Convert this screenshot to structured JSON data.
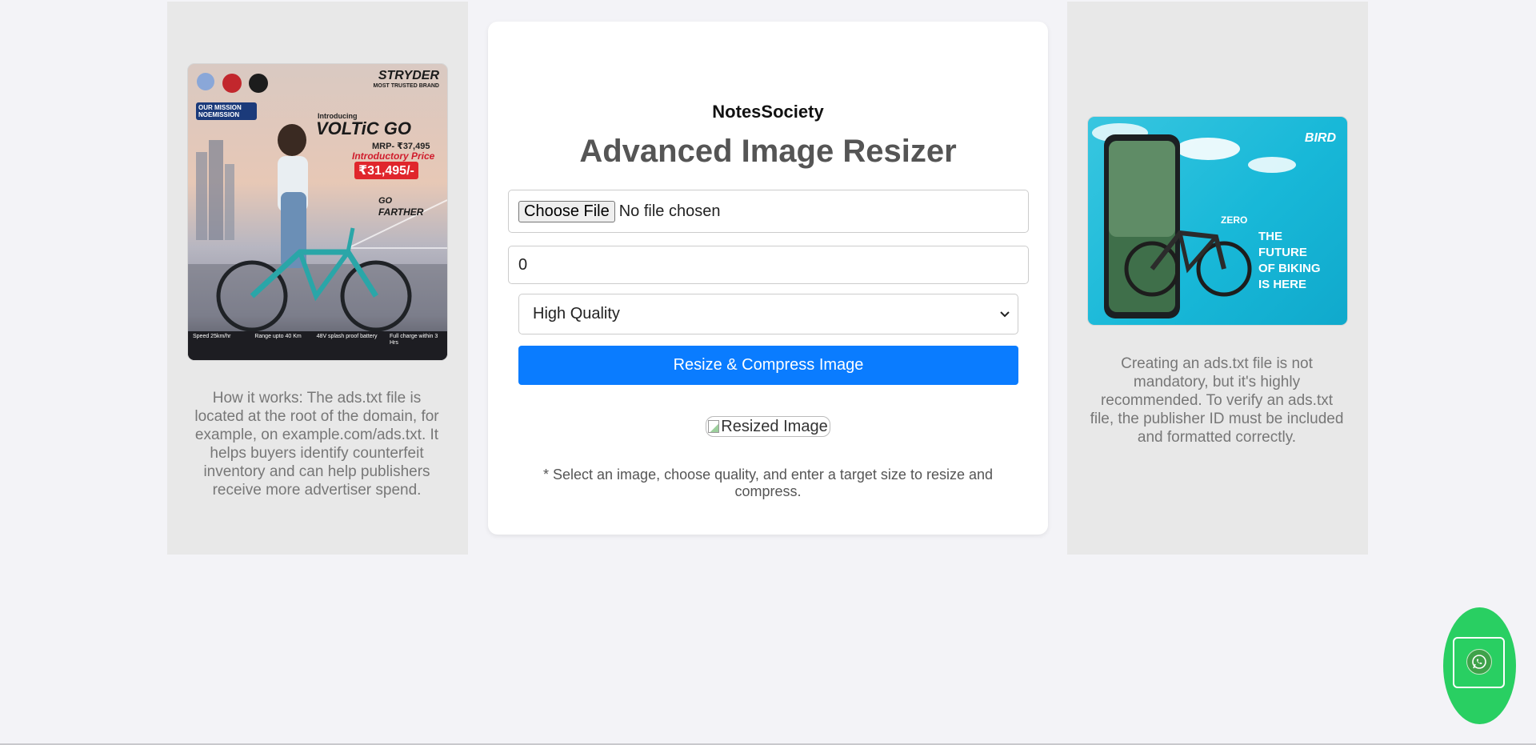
{
  "brand": "NotesSociety",
  "title": "Advanced Image Resizer",
  "file_input": {
    "button_label": "Choose File",
    "status": "No file chosen"
  },
  "target_size": {
    "value": "0"
  },
  "quality_select": {
    "selected": "High Quality"
  },
  "resize_button": "Resize & Compress Image",
  "resized_image_alt": "Resized Image",
  "note": "* Select an image, choose quality, and enter a target size to resize and compress.",
  "left_sidebar": {
    "text": "How it works: The ads.txt file is located at the root of the domain, for example, on example.com/ads.txt. It helps buyers identify counterfeit inventory and can help publishers receive more advertiser spend.",
    "ad": {
      "brand": "STRYDER",
      "brand_tagline": "MOST TRUSTED BRAND",
      "badge": "OUR MISSION NOEMISSION",
      "intro": "Introducing",
      "product": "VOLTiC GO",
      "mrp": "MRP- ₹37,495",
      "offer_label": "Introductory Price",
      "price": "₹31,495/-",
      "slogan_1": "GO",
      "slogan_2": "FARTHER",
      "specs": [
        "Speed 25km/hr",
        "Range upto 40 Km",
        "48V splash proof battery",
        "Full charge within 3 Hrs"
      ]
    }
  },
  "right_sidebar": {
    "text": "Creating an ads.txt file is not mandatory, but it's highly recommended. To verify an ads.txt file, the publisher ID must be included and formatted correctly.",
    "ad": {
      "brand": "BIRD",
      "model": "ZERO",
      "headline_lines": [
        "THE",
        "FUTURE",
        "OF BIKING",
        "IS HERE"
      ]
    }
  },
  "colors": {
    "page_bg": "#f3f3f7",
    "sidebar_bg": "#e8e8e8",
    "primary_button": "#0a7cff",
    "whatsapp_green": "#29cf62"
  }
}
